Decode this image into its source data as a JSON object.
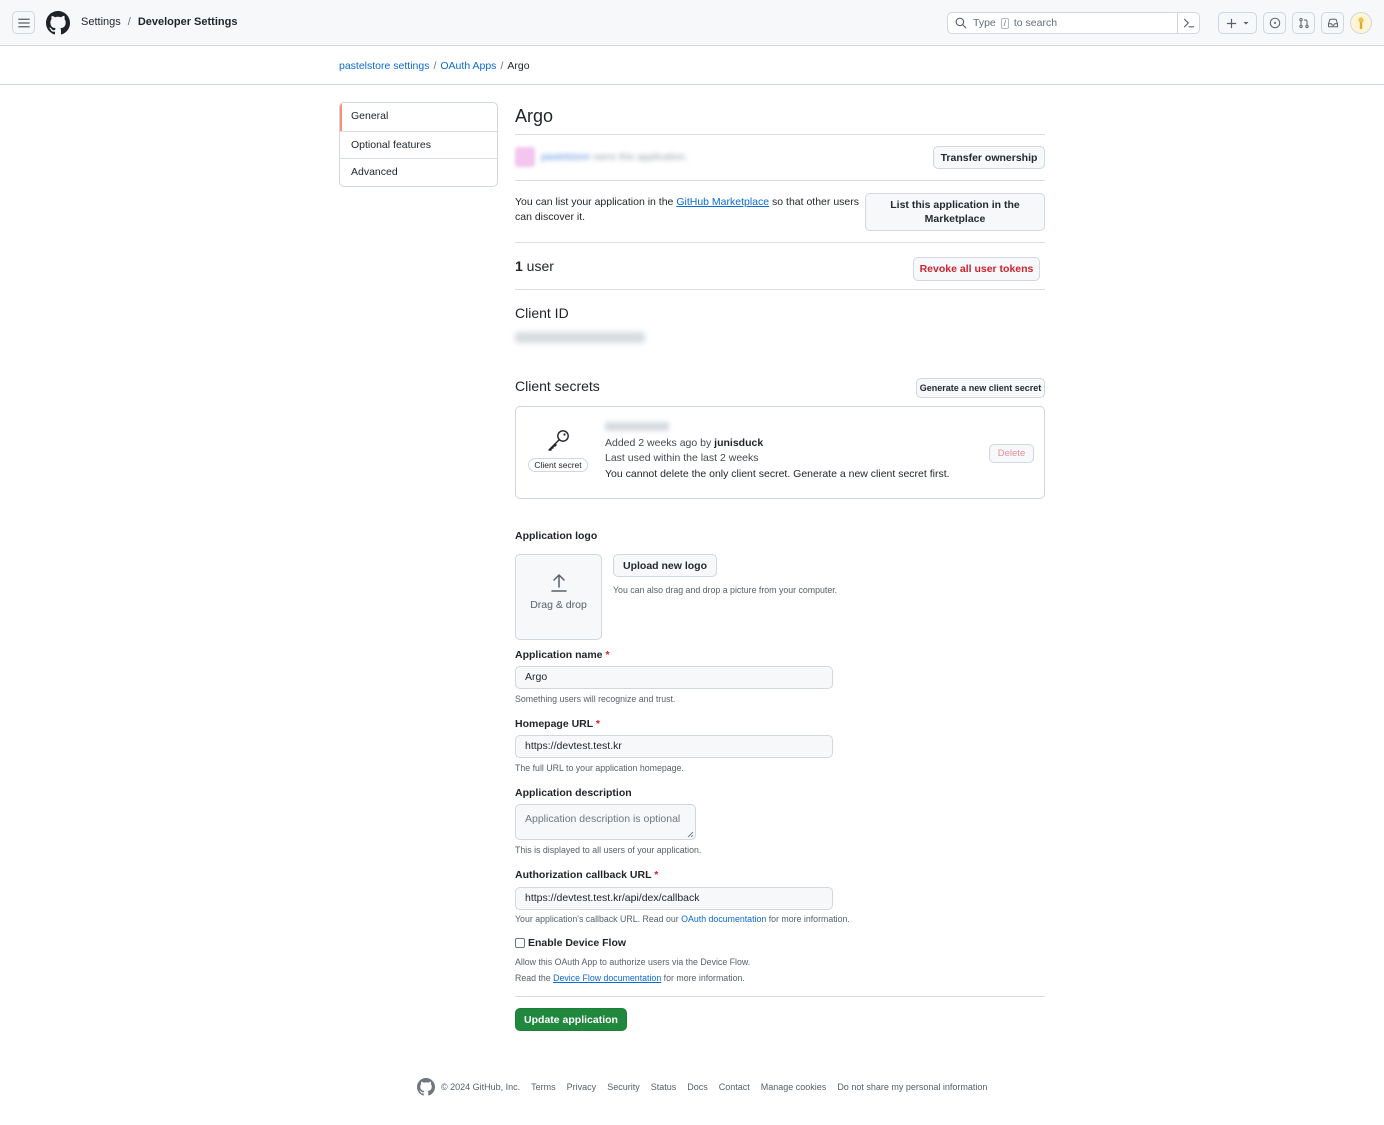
{
  "header": {
    "crumbs": [
      "Settings",
      "Developer Settings"
    ],
    "search_prefix": "Type",
    "search_key": "/",
    "search_suffix": "to search"
  },
  "breadcrumb": [
    "pastelstore settings",
    "OAuth Apps",
    "Argo"
  ],
  "sidebar": {
    "items": [
      {
        "label": "General"
      },
      {
        "label": "Optional features"
      },
      {
        "label": "Advanced"
      }
    ]
  },
  "app": {
    "title": "Argo",
    "transfer_label": "Transfer ownership",
    "market_text_before": "You can list your application in the ",
    "market_link": "GitHub Marketplace",
    "market_text_after": " so that other users can discover it.",
    "list_button_line1": "List this application in the",
    "list_button_line2": "Marketplace",
    "users_count": "1",
    "users_label": " user",
    "revoke_label": "Revoke all user tokens",
    "client_id_heading": "Client ID",
    "secrets_heading": "Client secrets",
    "generate_label": "Generate a new client secret"
  },
  "secret": {
    "pill": "Client secret",
    "added_prefix": "Added 2 weeks ago by ",
    "added_by": "junisduck",
    "last_used": "Last used within the last 2 weeks",
    "warning": "You cannot delete the only client secret. Generate a new client secret first.",
    "delete_label": "Delete"
  },
  "form": {
    "logo_label": "Application logo",
    "drop_text": "Drag & drop",
    "upload_label": "Upload new logo",
    "upload_hint": "You can also drag and drop a picture from your computer.",
    "name_label": "Application name",
    "required_mark": "*",
    "name_value": "Argo",
    "name_hint": "Something users will recognize and trust.",
    "homepage_label": "Homepage URL",
    "homepage_value": "https://devtest.test.kr",
    "homepage_hint": "The full URL to your application homepage.",
    "desc_label": "Application description",
    "desc_placeholder": "Application description is optional",
    "desc_hint": "This is displayed to all users of your application.",
    "callback_label": "Authorization callback URL",
    "callback_value": "https://devtest.test.kr/api/dex/callback",
    "callback_hint_before": "Your application's callback URL. Read our ",
    "callback_hint_link": "OAuth documentation",
    "callback_hint_after": " for more information.",
    "device_flow_label": "Enable Device Flow",
    "device_flow_hint1": "Allow this OAuth App to authorize users via the Device Flow.",
    "device_flow_hint2_before": "Read the ",
    "device_flow_hint2_link": "Device Flow documentation",
    "device_flow_hint2_after": " for more information.",
    "update_label": "Update application"
  },
  "footer": {
    "copyright": "© 2024 GitHub, Inc.",
    "links": [
      "Terms",
      "Privacy",
      "Security",
      "Status",
      "Docs",
      "Contact",
      "Manage cookies",
      "Do not share my personal information"
    ]
  },
  "colors": {
    "accent": "#0969da",
    "danger": "#cf222e",
    "primary_button": "#1f883d",
    "nav_active": "#fd8c73"
  }
}
